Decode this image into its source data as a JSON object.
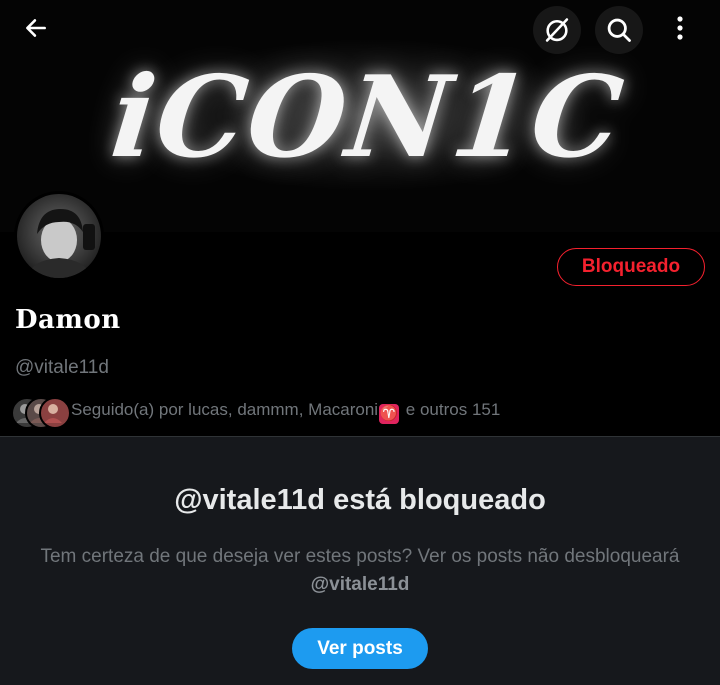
{
  "header": {
    "banner_text": "iCON1C",
    "back_icon": "arrow-left-icon",
    "discover_icon": "compass-off-icon",
    "search_icon": "search-icon",
    "more_icon": "more-vertical-icon"
  },
  "profile": {
    "display_name": "Damon",
    "handle": "@vitale11d",
    "blocked_label": "Bloqueado",
    "followed_by_prefix": "Seguido(a) por lucas, dammm, Macaroni",
    "followed_by_emoji": "♈",
    "followed_by_suffix": " e outros 151"
  },
  "blocked_notice": {
    "title": "@vitale11d está bloqueado",
    "description": "Tem certeza de que deseja ver estes posts? Ver os posts não desbloqueará ",
    "description_handle": "@vitale11d",
    "button_label": "Ver posts"
  },
  "colors": {
    "blocked_red": "#f4212e",
    "accent_blue": "#1d9bf0",
    "muted_text": "#71767b",
    "panel_bg": "#16181c"
  }
}
